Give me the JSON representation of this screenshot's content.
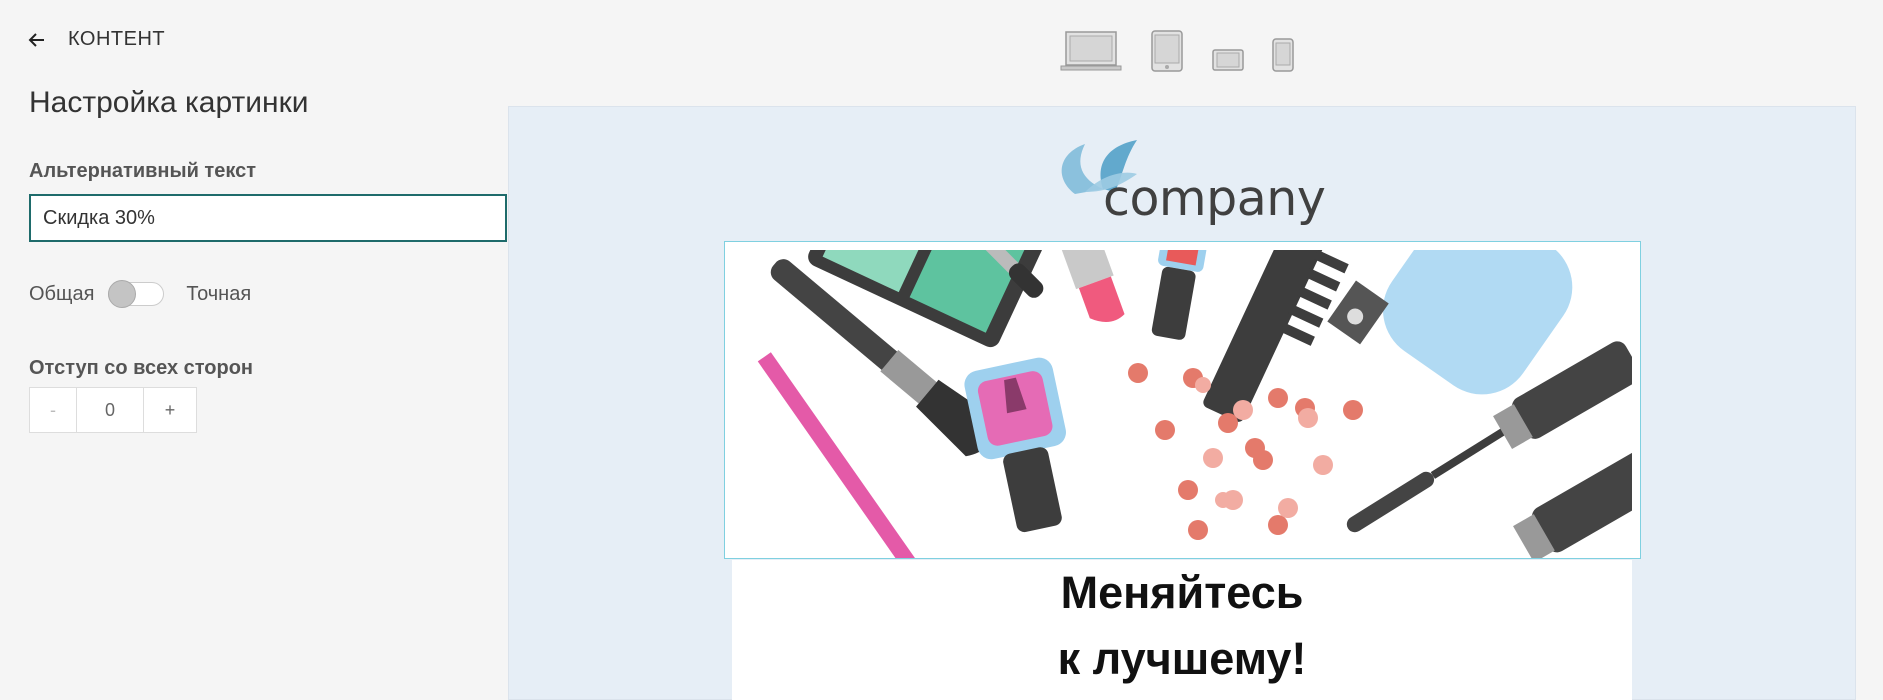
{
  "panel": {
    "back_label": "КОНТЕНТ",
    "title": "Настройка картинки",
    "alt_label": "Альтернативный текст",
    "alt_value": "Скидка 30%",
    "toggle_left": "Общая",
    "toggle_right": "Точная",
    "padding_label": "Отступ со всех сторон",
    "stepper": {
      "minus": "-",
      "value": "0",
      "plus": "+"
    }
  },
  "devices": [
    "laptop-icon",
    "tablet-icon",
    "tablet-landscape-icon",
    "phone-icon"
  ],
  "email": {
    "logo_text": "company",
    "headline_line1": "Меняйтесь",
    "headline_line2": "к лучшему!"
  },
  "colors": {
    "accent": "#1e6b6b",
    "canvas_bg": "#e6eef6",
    "selection": "#7fd0e0"
  }
}
